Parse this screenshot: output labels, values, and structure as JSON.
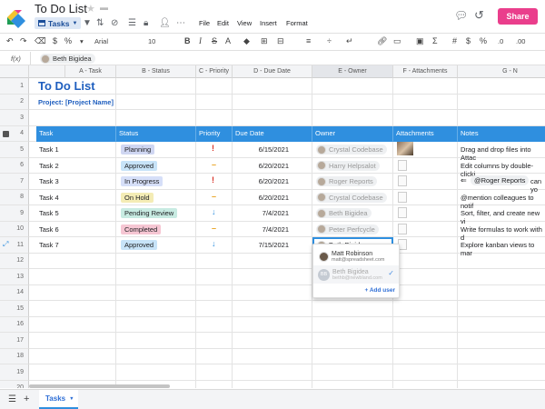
{
  "app": {
    "doc_title": "To Do List",
    "view": "Tasks",
    "share": "Share",
    "menu": [
      "File",
      "Edit",
      "View",
      "Insert",
      "Format"
    ]
  },
  "format": {
    "font": "Arial",
    "size": "10"
  },
  "fx": {
    "label": "f(x)",
    "chip": "Beth Bigidea"
  },
  "columns": [
    "A - Task",
    "B - Status",
    "C - Priority",
    "D - Due Date",
    "E - Owner",
    "F - Attachments",
    "G - N"
  ],
  "rows_num": [
    "1",
    "2",
    "3",
    "4",
    "5",
    "6",
    "7",
    "8",
    "9",
    "10",
    "11",
    "12",
    "13",
    "14",
    "15",
    "16",
    "17",
    "18",
    "19",
    "20"
  ],
  "sheet": {
    "title": "To Do List",
    "project": "Project: [Project Name]"
  },
  "header": [
    "Task",
    "Status",
    "Priority",
    "Due Date",
    "Owner",
    "Attachments",
    "Notes"
  ],
  "tasks": [
    {
      "task": "Task 1",
      "status": "Planning",
      "priority": "!",
      "due": "6/15/2021",
      "owner": "Crystal Codebase",
      "note": "Drag and drop files into Attac"
    },
    {
      "task": "Task 2",
      "status": "Approved",
      "priority": "–",
      "due": "6/20/2021",
      "owner": "Harry Helpsalot",
      "note": "Edit columns by double-clicki"
    },
    {
      "task": "Task 3",
      "status": "In Progress",
      "priority": "!",
      "due": "6/20/2021",
      "owner": "Roger Reports",
      "note": "can yo"
    },
    {
      "task": "Task 4",
      "status": "On Hold",
      "priority": "–",
      "due": "6/20/2021",
      "owner": "Crystal Codebase",
      "note": "@mention colleagues to notif"
    },
    {
      "task": "Task 5",
      "status": "Pending Review",
      "priority": "↓",
      "due": "7/4/2021",
      "owner": "Beth Bigidea",
      "note": "Sort, filter, and create new vi"
    },
    {
      "task": "Task 6",
      "status": "Completed",
      "priority": "–",
      "due": "7/4/2021",
      "owner": "Peter Perfcycle",
      "note": "Write formulas to work with d"
    },
    {
      "task": "Task 7",
      "status": "Approved",
      "priority": "↓",
      "due": "7/15/2021",
      "owner": "Beth Bigidea",
      "note": "Explore kanban views to mar"
    }
  ],
  "note_mention": "@Roger Reports",
  "dropdown": {
    "u1_name": "Matt Robinson",
    "u1_mail": "matt@spreadsheet.com",
    "u2_name": "Beth Bigidea",
    "u2_mail": "bethb@newbland.com",
    "add": "+ Add user",
    "u2_initials": "BB"
  },
  "sheet_tab": "Tasks",
  "colors": {
    "accent": "#2f8fdf",
    "share": "#ea3e8c",
    "title": "#1f5fbf"
  }
}
